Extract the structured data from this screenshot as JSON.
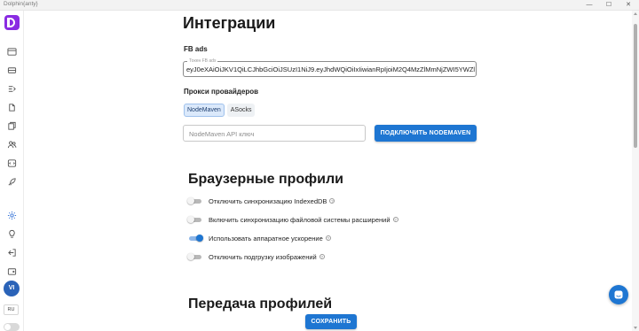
{
  "window": {
    "title": "Dolphin{anty}",
    "minimize": "—",
    "maximize": "☐",
    "close": "✕"
  },
  "sidebar": {
    "nav_icons": [
      "browser-profiles-icon",
      "proxy-icon",
      "automation-icon",
      "extensions-icon",
      "bookmarks-icon",
      "team-icon",
      "api-icon",
      "rocket-icon",
      "settings-icon",
      "lightbulb-icon",
      "logout-icon",
      "wallet-icon"
    ],
    "active_icon": "settings-icon",
    "avatar_initials": "VI",
    "language": "RU",
    "theme_toggle_on": false
  },
  "integrations": {
    "title": "Интеграции",
    "fb_ads_label": "FB ads",
    "token_legend": "Токен FB ads",
    "token_value": "eyJ0eXAiOiJKV1QiLCJhbGciOiJSUzI1NiJ9.eyJhdWQiOiIxIiwianRpIjoiM2Q4MzZlMmNjZWI5YWZl",
    "proxy_label": "Прокси провайдеров",
    "proxy_tabs": [
      {
        "label": "NodeMaven",
        "selected": true
      },
      {
        "label": "ASocks",
        "selected": false
      }
    ],
    "api_placeholder": "NodeMaven API ключ",
    "connect_button": "ПОДКЛЮЧИТЬ NODEMAVEN"
  },
  "browser_profiles": {
    "title": "Браузерные профили",
    "options": [
      {
        "label": "Отключить синхронизацию IndexedDB",
        "enabled": false
      },
      {
        "label": "Включить синхронизацию файловой системы расширений",
        "enabled": false
      },
      {
        "label": "Использовать аппаратное ускорение",
        "enabled": true
      },
      {
        "label": "Отключить подгрузку изображений",
        "enabled": false
      }
    ],
    "help_glyph": "?"
  },
  "profile_transfer": {
    "title": "Передача профилей"
  },
  "save_button": "СОХРАНИТЬ",
  "colors": {
    "accent": "#1e76d2",
    "logo": "#8a2be2",
    "avatar": "#2a63b8"
  }
}
